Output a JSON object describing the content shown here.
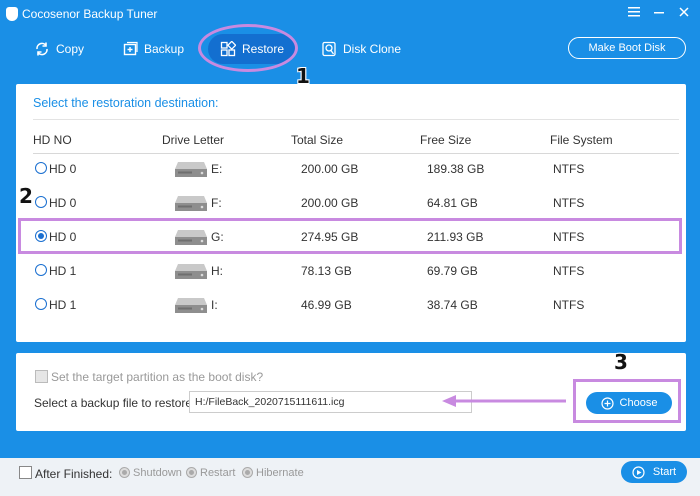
{
  "window": {
    "title": "Cocosenor Backup Tuner",
    "menu_icon": "hamburger-menu-icon",
    "minimize_icon": "minimize-icon",
    "close_icon": "close-icon"
  },
  "toolbar": {
    "copy_label": "Copy",
    "backup_label": "Backup",
    "restore_label": "Restore",
    "disk_clone_label": "Disk Clone",
    "boot_disk_label": "Make Boot Disk"
  },
  "annotations": {
    "step1": "1",
    "step2": "2",
    "step3": "3",
    "color": "#c88ae0"
  },
  "restore_panel": {
    "title": "Select the restoration destination:",
    "columns": [
      "HD NO",
      "Drive Letter",
      "Total Size",
      "Free Size",
      "File System"
    ],
    "rows": [
      {
        "hd": "HD 0",
        "letter": "E:",
        "total": "200.00 GB",
        "free": "189.38 GB",
        "fs": "NTFS",
        "selected": false
      },
      {
        "hd": "HD 0",
        "letter": "F:",
        "total": "200.00 GB",
        "free": "64.81 GB",
        "fs": "NTFS",
        "selected": false
      },
      {
        "hd": "HD 0",
        "letter": "G:",
        "total": "274.95 GB",
        "free": "211.93 GB",
        "fs": "NTFS",
        "selected": true
      },
      {
        "hd": "HD 1",
        "letter": "H:",
        "total": "78.13 GB",
        "free": "69.79 GB",
        "fs": "NTFS",
        "selected": false
      },
      {
        "hd": "HD 1",
        "letter": "I:",
        "total": "46.99 GB",
        "free": "38.74 GB",
        "fs": "NTFS",
        "selected": false
      }
    ]
  },
  "bottom_panel": {
    "boot_checkbox_label": "Set the target partition as the boot disk?",
    "file_label": "Select a backup file to restore:",
    "file_value": "H:/FileBack_2020715111611.icg",
    "choose_label": "Choose"
  },
  "footer": {
    "after_finished_label": "After Finished:",
    "shutdown_label": "Shutdown",
    "restart_label": "Restart",
    "hibernate_label": "Hibernate",
    "start_label": "Start"
  },
  "colors": {
    "accent": "#1a8fe6",
    "accent_dark": "#136fd0"
  }
}
